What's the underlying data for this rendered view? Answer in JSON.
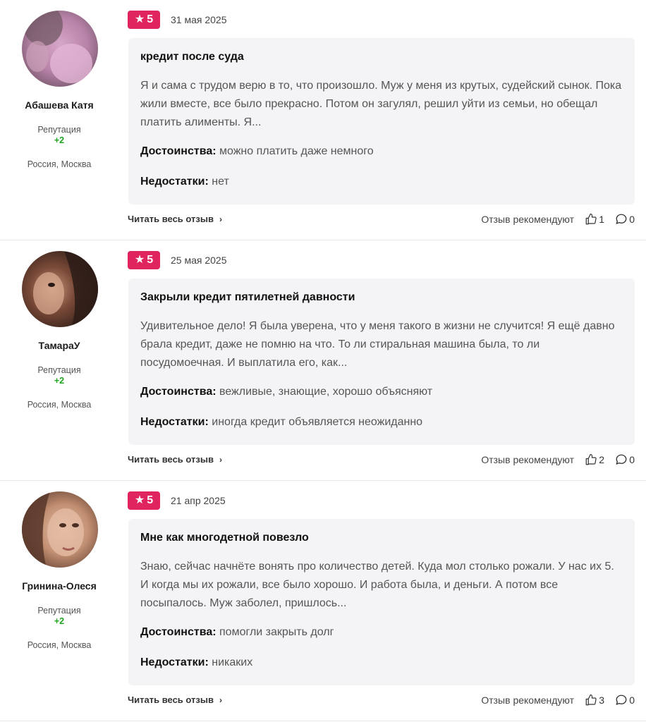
{
  "labels": {
    "reputation": "Репутация",
    "pros": "Достоинства:",
    "cons": "Недостатки:",
    "read_more": "Читать весь отзыв",
    "recommend": "Отзыв рекомендуют"
  },
  "colors": {
    "badge": "#e0245e",
    "reputation_positive": "#1ea31e",
    "card_bg": "#f4f4f6"
  },
  "icons": {
    "rating": "star-icon",
    "read_more": "chevron-right-icon",
    "likes": "thumbs-up-icon",
    "comments": "comment-bubble-icon"
  },
  "reviews": [
    {
      "author": "Абашева Катя",
      "reputation": "+2",
      "location": "Россия, Москва",
      "rating": "5",
      "date": "31 мая 2025",
      "title": "кредит после суда",
      "excerpt": "Я и сама с трудом верю в то, что произошло. Муж у меня из крутых, судейский сынок. Пока жили вместе, все было прекрасно. Потом он загулял, решил уйти из семьи, но обещал платить алименты. Я...",
      "pros": "можно платить даже немного",
      "cons": "нет",
      "likes": "1",
      "comments": "0"
    },
    {
      "author": "ТамараУ",
      "reputation": "+2",
      "location": "Россия, Москва",
      "rating": "5",
      "date": "25 мая 2025",
      "title": "Закрыли кредит пятилетней давности",
      "excerpt": "Удивительное дело! Я была уверена, что у меня такого в жизни не случится! Я ещё давно брала кредит, даже не помню на что. То ли стиральная машина была, то ли посудомоечная. И выплатила его, как...",
      "pros": "вежливые, знающие, хорошо объясняют",
      "cons": "иногда кредит объявляется неожиданно",
      "likes": "2",
      "comments": "0"
    },
    {
      "author": "Гринина-Олеся",
      "reputation": "+2",
      "location": "Россия, Москва",
      "rating": "5",
      "date": "21 апр 2025",
      "title": "Мне как многодетной повезло",
      "excerpt": "Знаю, сейчас начнёте вонять про количество детей. Куда мол столько рожали. У нас их 5. И когда мы их рожали, все было хорошо. И работа была, и деньги. А потом все посыпалось. Муж заболел, пришлось...",
      "pros": "помогли закрыть долг",
      "cons": "никаких",
      "likes": "3",
      "comments": "0"
    }
  ]
}
